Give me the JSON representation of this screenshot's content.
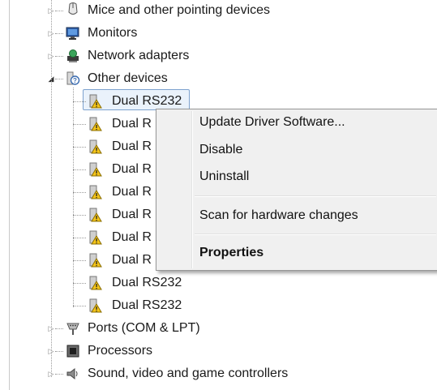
{
  "tree": {
    "nodes": [
      {
        "label": "Mice and other pointing devices",
        "icon": "mouse-icon",
        "expander": "collapsed"
      },
      {
        "label": "Monitors",
        "icon": "monitor-icon",
        "expander": "collapsed"
      },
      {
        "label": "Network adapters",
        "icon": "network-adapter-icon",
        "expander": "collapsed"
      },
      {
        "label": "Other devices",
        "icon": "unknown-device-icon",
        "expander": "expanded"
      }
    ],
    "other_devices_children": [
      "Dual RS232",
      "Dual R",
      "Dual R",
      "Dual R",
      "Dual R",
      "Dual R",
      "Dual R",
      "Dual R",
      "Dual RS232",
      "Dual RS232"
    ],
    "nodes_after": [
      {
        "label": "Ports (COM & LPT)",
        "icon": "port-icon",
        "expander": "collapsed"
      },
      {
        "label": "Processors",
        "icon": "processor-icon",
        "expander": "collapsed"
      },
      {
        "label": "Sound, video and game controllers",
        "icon": "speaker-icon",
        "expander": "collapsed"
      }
    ]
  },
  "context_menu": {
    "update_driver": "Update Driver Software...",
    "disable": "Disable",
    "uninstall": "Uninstall",
    "scan": "Scan for hardware changes",
    "properties": "Properties"
  },
  "colors": {
    "selection_fill": "#eaf2fb",
    "selection_border": "#7da2ce",
    "warning_yellow": "#f5c518",
    "menu_bg": "#f0f0f0"
  }
}
